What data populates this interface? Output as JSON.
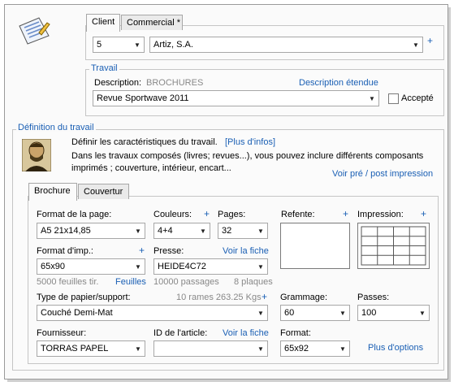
{
  "header_tabs": {
    "client": "Client",
    "commercial": "Commercial *"
  },
  "client": {
    "code": "5",
    "name": "Artiz, S.A.",
    "add": "+"
  },
  "travail": {
    "legend": "Travail",
    "description_label": "Description:",
    "description_value": "BROCHURES",
    "description_link": "Description étendue",
    "title_value": "Revue Sportwave 2011",
    "accepte_label": "Accepté"
  },
  "definition": {
    "legend": "Définition du travail",
    "line1": "Définir les caractéristiques du travail.",
    "more_link": "[Plus d'infos]",
    "line2": "Dans les travaux composés (livres; revues...), vous pouvez inclure différents composants",
    "line3": "imprimés ; couverture, intérieur, encart...",
    "prepost_link": "Voir pré / post impression"
  },
  "component_tabs": {
    "brochure": "Brochure",
    "couverture": "Couvertur"
  },
  "form": {
    "format_page_label": "Format de la page:",
    "format_page_value": "A5 21x14,85",
    "couleurs_label": "Couleurs:",
    "couleurs_value": "4+4",
    "pages_label": "Pages:",
    "pages_value": "32",
    "refente_label": "Refente:",
    "impression_label": "Impression:",
    "format_imp_label": "Format d'imp.:",
    "format_imp_value": "65x90",
    "presse_label": "Presse:",
    "presse_link": "Voir la fiche",
    "presse_value": "HEIDE4C72",
    "feuilles_info": "5000 feuilles tir.",
    "feuilles_link": "Feuilles",
    "passages_info": "10000 passages",
    "plaques_info": "8 plaques",
    "papier_label": "Type de papier/support:",
    "rames_info": "10 rames 263.25 Kgs",
    "papier_value": "Couché Demi-Mat",
    "grammage_label": "Grammage:",
    "grammage_value": "60",
    "passes_label": "Passes:",
    "passes_value": "100",
    "fournisseur_label": "Fournisseur:",
    "fournisseur_value": "TORRAS PAPEL",
    "article_label": "ID de l'article:",
    "article_link": "Voir la fiche",
    "article_value": "",
    "format_label": "Format:",
    "format_value": "65x92",
    "options_link": "Plus d'options",
    "plus": "+"
  }
}
